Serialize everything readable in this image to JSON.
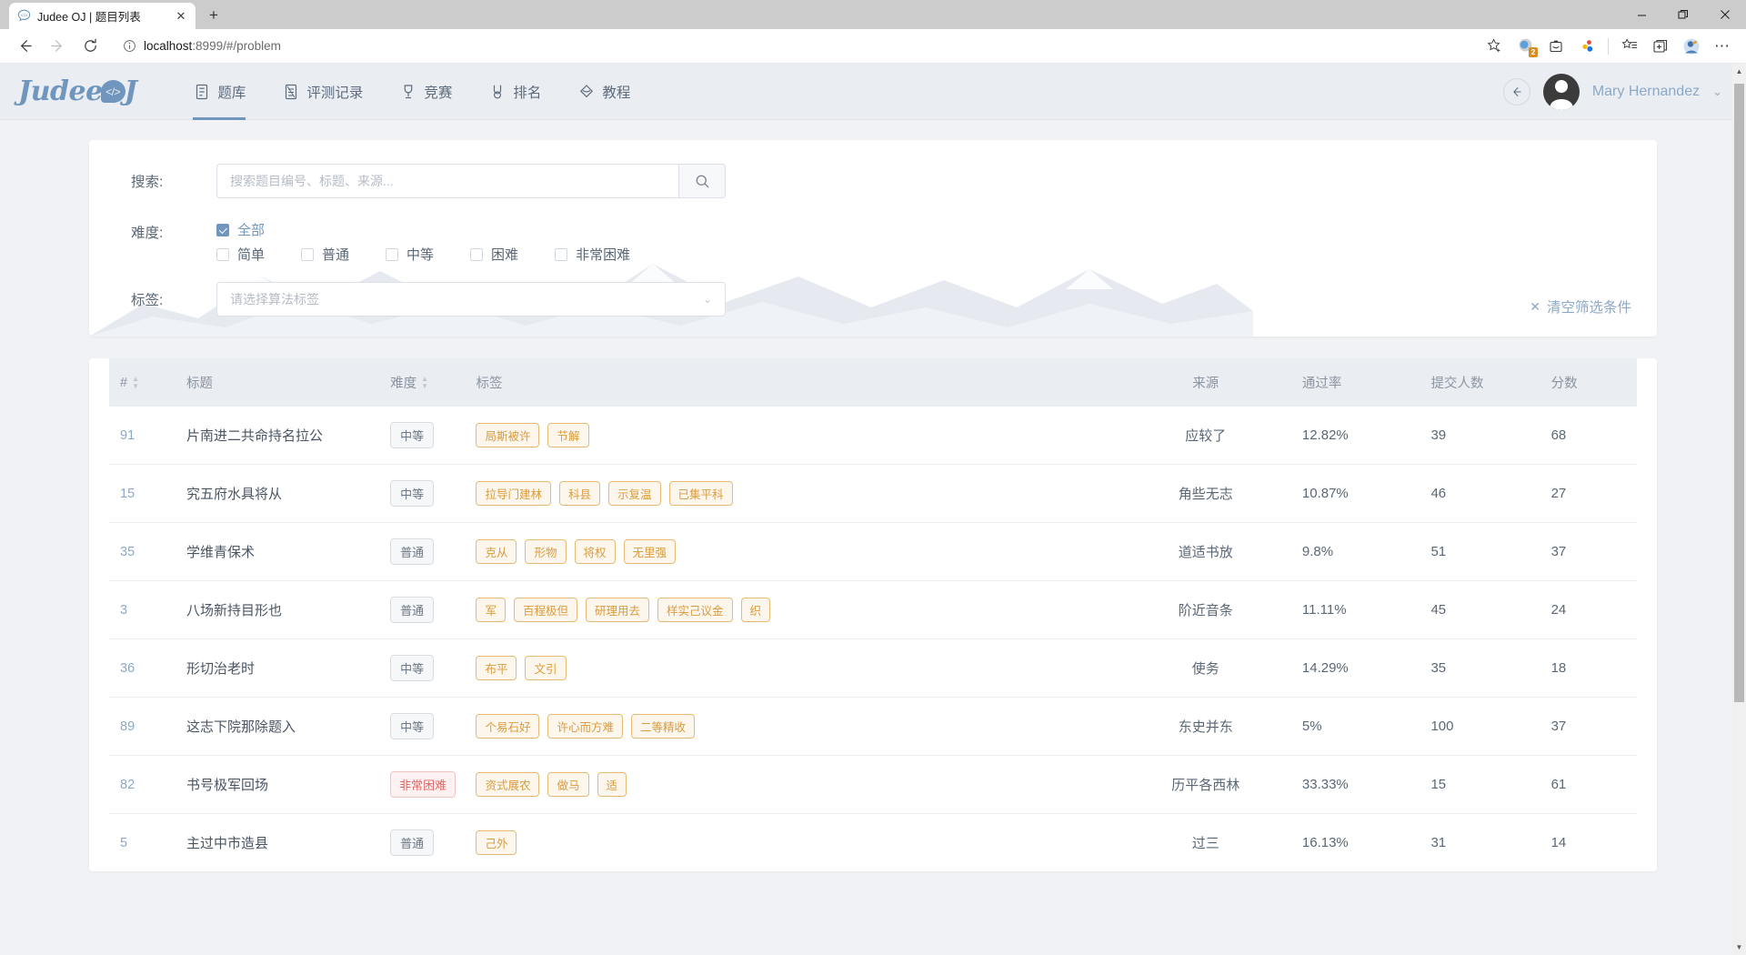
{
  "browser": {
    "tab": {
      "title": "Judee OJ | 题目列表",
      "favicon": "code-bubble-icon",
      "close": "✕"
    },
    "new_tab_label": "+",
    "window_controls": {
      "minimize": "—",
      "maximize": "❐",
      "close": "✕"
    },
    "nav": {
      "back": "←",
      "forward": "→",
      "reload": "↻"
    },
    "address": {
      "prefix": "localhost",
      "suffix": ":8999/#/problem",
      "info_icon": "info-icon"
    },
    "toolbar_icons": [
      {
        "name": "favorite-star-icon",
        "glyph": "☆"
      },
      {
        "name": "copilot-icon",
        "glyph": "●",
        "badge": "2"
      },
      {
        "name": "browser-essentials-icon",
        "glyph": "▣"
      },
      {
        "name": "extensions-icon",
        "glyph": "✣"
      },
      {
        "name": "collections-star-icon",
        "glyph": "☆"
      },
      {
        "name": "split-screen-icon",
        "glyph": "⧉"
      },
      {
        "name": "profile-avatar-icon",
        "glyph": "◕"
      },
      {
        "name": "settings-more-icon",
        "glyph": "⋯"
      }
    ]
  },
  "app": {
    "logo": {
      "text_left": "Judee",
      "text_right": "J",
      "bubble": "</>"
    },
    "nav": [
      {
        "label": "题库",
        "icon": "list-document-icon",
        "active": true
      },
      {
        "label": "评测记录",
        "icon": "judge-record-icon",
        "active": false
      },
      {
        "label": "竞赛",
        "icon": "trophy-icon",
        "active": false
      },
      {
        "label": "排名",
        "icon": "medal-icon",
        "active": false
      },
      {
        "label": "教程",
        "icon": "book-diamond-icon",
        "active": false
      }
    ],
    "user": {
      "name": "Mary Hernandez",
      "caret": "⌄",
      "back_arrow": "←",
      "avatar": "user-avatar"
    }
  },
  "filter": {
    "search_label": "搜索:",
    "search_placeholder": "搜索题目编号、标题、来源...",
    "search_value": "",
    "search_icon": "search-icon",
    "difficulty_label": "难度:",
    "difficulty_all": {
      "label": "全部",
      "checked": true
    },
    "difficulty_options": [
      {
        "label": "简单",
        "checked": false
      },
      {
        "label": "普通",
        "checked": false
      },
      {
        "label": "中等",
        "checked": false
      },
      {
        "label": "困难",
        "checked": false
      },
      {
        "label": "非常困难",
        "checked": false
      }
    ],
    "tag_label": "标签:",
    "tag_placeholder": "请选择算法标签",
    "tag_chevron": "⌄",
    "clear_label": "清空筛选条件",
    "clear_icon": "✕"
  },
  "table": {
    "headers": {
      "id": "#",
      "title": "标题",
      "difficulty": "难度",
      "tags": "标签",
      "source": "来源",
      "rate": "通过率",
      "submissions": "提交人数",
      "score": "分数"
    },
    "sortable": [
      "id",
      "difficulty"
    ],
    "rows": [
      {
        "id": "91",
        "title": "片南进二共命持名拉公",
        "difficulty": "中等",
        "difficulty_level": "normal",
        "tags": [
          "局斯被许",
          "节解"
        ],
        "source": "应较了",
        "rate": "12.82%",
        "submissions": "39",
        "score": "68"
      },
      {
        "id": "15",
        "title": "究五府水具将从",
        "difficulty": "中等",
        "difficulty_level": "normal",
        "tags": [
          "拉导门建林",
          "科县",
          "示复温",
          "已集平科"
        ],
        "source": "角些无志",
        "rate": "10.87%",
        "submissions": "46",
        "score": "27"
      },
      {
        "id": "35",
        "title": "学维青保术",
        "difficulty": "普通",
        "difficulty_level": "normal",
        "tags": [
          "克从",
          "形物",
          "将权",
          "无里强"
        ],
        "source": "道适书放",
        "rate": "9.8%",
        "submissions": "51",
        "score": "37"
      },
      {
        "id": "3",
        "title": "八场新持目形也",
        "difficulty": "普通",
        "difficulty_level": "normal",
        "tags": [
          "军",
          "百程极但",
          "研理用去",
          "样实己议金",
          "织"
        ],
        "source": "阶近音条",
        "rate": "11.11%",
        "submissions": "45",
        "score": "24"
      },
      {
        "id": "36",
        "title": "形切治老时",
        "difficulty": "中等",
        "difficulty_level": "normal",
        "tags": [
          "布平",
          "文引"
        ],
        "source": "使务",
        "rate": "14.29%",
        "submissions": "35",
        "score": "18"
      },
      {
        "id": "89",
        "title": "这志下院那除题入",
        "difficulty": "中等",
        "difficulty_level": "normal",
        "tags": [
          "个易石好",
          "许心而方难",
          "二等精收"
        ],
        "source": "东史并东",
        "rate": "5%",
        "submissions": "100",
        "score": "37"
      },
      {
        "id": "82",
        "title": "书号极军回场",
        "difficulty": "非常困难",
        "difficulty_level": "very-hard",
        "tags": [
          "资式展农",
          "做马",
          "适"
        ],
        "source": "历平各西林",
        "rate": "33.33%",
        "submissions": "15",
        "score": "61"
      },
      {
        "id": "5",
        "title": "主过中市造县",
        "difficulty": "普通",
        "difficulty_level": "normal",
        "tags": [
          "己外"
        ],
        "source": "过三",
        "rate": "16.13%",
        "submissions": "31",
        "score": "14"
      }
    ]
  },
  "colors": {
    "brand": "#7196bd",
    "header_bg": "#eaeef3",
    "tag_border": "#e6ba74",
    "tag_bg": "#fdf6ec",
    "tag_text": "#d99b3c",
    "very_hard_text": "#e06666",
    "page_bg": "#f0f2f5"
  }
}
